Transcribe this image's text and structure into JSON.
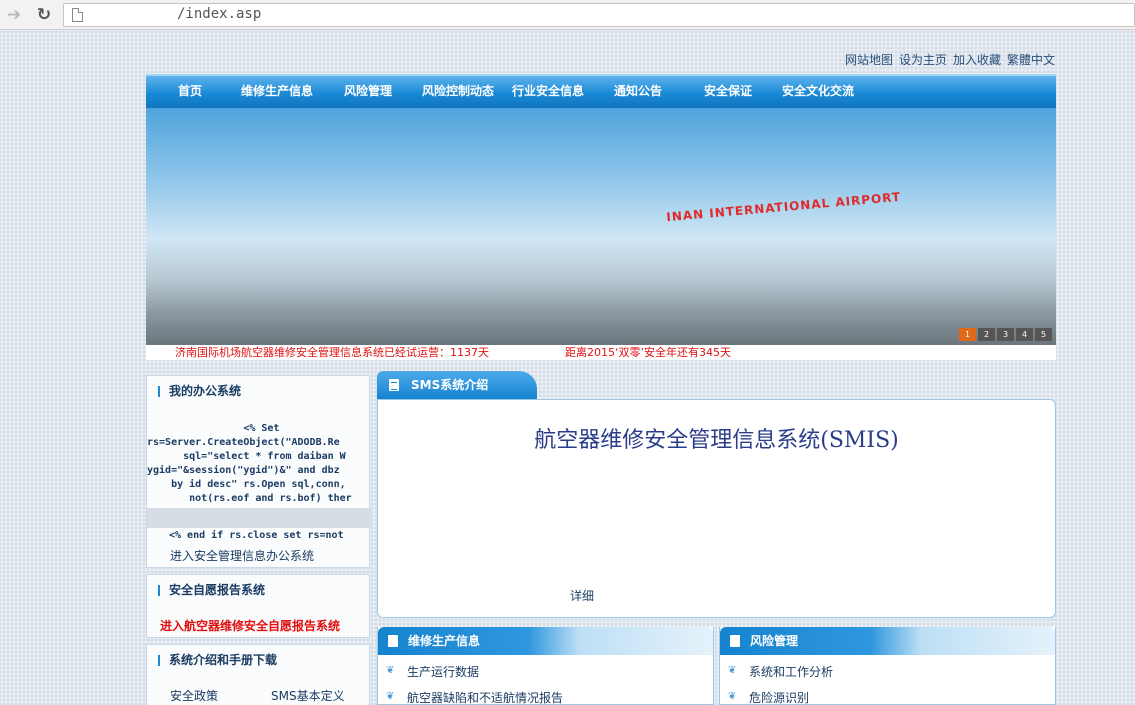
{
  "browser": {
    "url": "/index.asp"
  },
  "top_links": [
    "网站地图",
    "设为主页",
    "加入收藏",
    "繁體中文"
  ],
  "nav": [
    "首页",
    "维修生产信息",
    "风险管理",
    "风险控制动态",
    "行业安全信息",
    "通知公告",
    "安全保证",
    "安全文化交流"
  ],
  "banner": {
    "sign_text": "INAN INTERNATIONAL AIRPORT",
    "slides": [
      "1",
      "2",
      "3",
      "4",
      "5"
    ],
    "active_slide": "1"
  },
  "ticker": {
    "running": "济南国际机场航空器维修安全管理信息系统已经试运营：1137天",
    "countdown": "距离2015‘双零’安全年还有345天"
  },
  "left": {
    "office": {
      "title": "我的办公系统",
      "code": "                <% Set\nrs=Server.CreateObject(\"ADODB.Re\n      sql=\"select * from daiban W\nygid=\"&session(\"ygid\")&\" and dbz\n    by id desc\" rs.Open sql,conn,\n       not(rs.eof and rs.bof) ther",
      "code_end": "<% end if rs.close set rs=not",
      "link": "进入安全管理信息办公系统"
    },
    "report": {
      "title": "安全自愿报告系统",
      "link": "进入航空器维修安全自愿报告系统"
    },
    "manual": {
      "title": "系统介绍和手册下载",
      "items": [
        "安全政策",
        "SMS基本定义"
      ]
    }
  },
  "sms": {
    "tab": "SMS系统介绍",
    "title": "航空器维修安全管理信息系统(SMIS)",
    "detail": "详细"
  },
  "production": {
    "tab": "维修生产信息",
    "items": [
      "生产运行数据",
      "航空器缺陷和不适航情况报告"
    ]
  },
  "risk": {
    "tab": "风险管理",
    "items": [
      "系统和工作分析",
      "危险源识别"
    ]
  }
}
